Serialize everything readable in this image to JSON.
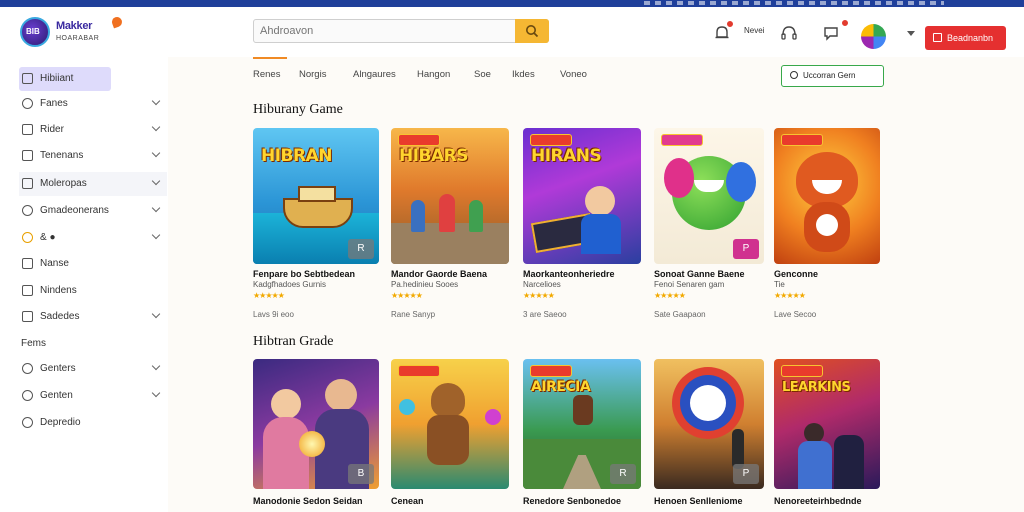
{
  "brand": {
    "name_line1": "Makker",
    "name_line2": "HOARABAR",
    "monogram": "BIB"
  },
  "search": {
    "placeholder": "Ahdroavon",
    "icon": "search-icon"
  },
  "header": {
    "small_text": "Nevei",
    "signin_label": "Beadnanbn"
  },
  "sidebar": {
    "items": [
      {
        "label": "Hibiiant",
        "icon": "grid-icon",
        "chevron": false
      },
      {
        "label": "Fanes",
        "icon": "user-icon",
        "chevron": true
      },
      {
        "label": "Rider",
        "icon": "gamepad-icon",
        "chevron": true
      },
      {
        "label": "Tenenans",
        "icon": "image-icon",
        "chevron": true
      },
      {
        "label": "Moleropas",
        "icon": "puzzle-icon",
        "chevron": true
      },
      {
        "label": "Gmadeonerans",
        "icon": "shield-icon",
        "chevron": true
      },
      {
        "label": "& ●",
        "icon": "coin-icon",
        "chevron": true
      },
      {
        "label": "Nanse",
        "icon": "doc-icon",
        "chevron": false
      },
      {
        "label": "Nindens",
        "icon": "book-icon",
        "chevron": false
      },
      {
        "label": "Sadedes",
        "icon": "box-icon",
        "chevron": true
      }
    ],
    "section_label": "Fems",
    "items2": [
      {
        "label": "Genters",
        "icon": "globe-icon",
        "chevron": true
      },
      {
        "label": "Genten",
        "icon": "compass-icon",
        "chevron": true
      },
      {
        "label": "Depredio",
        "icon": "settings-icon",
        "chevron": false
      }
    ]
  },
  "tabs": [
    "Renes",
    "Norgis",
    "Alngaures",
    "Hangon",
    "Soe",
    "Ikdes",
    "Voneo"
  ],
  "filter_button": "Uccorran Gern",
  "sections": [
    {
      "title": "Hiburany Game",
      "cards": [
        {
          "art": "HIBRAN",
          "title": "Fenpare bo Sebtbedean",
          "sub": "Kadgfhadoes Gurnis",
          "stars": "★★★★★",
          "meta": "Lavs 9i eoo",
          "tag": "R"
        },
        {
          "art": "HIBARS",
          "title": "Mandor Gaorde Baena",
          "sub": "Pa.hedinieu Sooes",
          "stars": "★★★★★",
          "meta": "Rane Sanyp",
          "tag": ""
        },
        {
          "art": "HIRANS",
          "title": "Maorkanteonheriedre",
          "sub": "Narcelioes",
          "stars": "★★★★★",
          "meta": "3 are Saeoo",
          "tag": ""
        },
        {
          "art": "",
          "title": "Sonoat Ganne Baene",
          "sub": "Fenoi Senaren gam",
          "stars": "★★★★★",
          "meta": "Sate Gaapaon",
          "tag": "P"
        },
        {
          "art": "",
          "title": "Genconne",
          "sub": "Tie",
          "stars": "★★★★★",
          "meta": "Lave Secoo",
          "tag": ""
        }
      ]
    },
    {
      "title": "Hibtran Grade",
      "cards": [
        {
          "art": "",
          "title": "Manodonie Sedon Seidan",
          "sub": "",
          "stars": "",
          "meta": "",
          "tag": "B"
        },
        {
          "art": "",
          "title": "Cenean",
          "sub": "",
          "stars": "",
          "meta": "",
          "tag": ""
        },
        {
          "art": "AIRECIA",
          "title": "Renedore Senbonedoe",
          "sub": "",
          "stars": "",
          "meta": "",
          "tag": "R"
        },
        {
          "art": "",
          "title": "Henoen Senlleniome",
          "sub": "",
          "stars": "",
          "meta": "",
          "tag": "P"
        },
        {
          "art": "LEARKINS",
          "title": "Nenoreeteirhbednde",
          "sub": "",
          "stars": "",
          "meta": "",
          "tag": ""
        }
      ]
    }
  ],
  "colors": {
    "accent_orange": "#f08a24",
    "signin_red": "#e53030",
    "filter_green": "#38a84a",
    "active_sidebar": "#dedbfb",
    "search_button": "#f5b733"
  }
}
